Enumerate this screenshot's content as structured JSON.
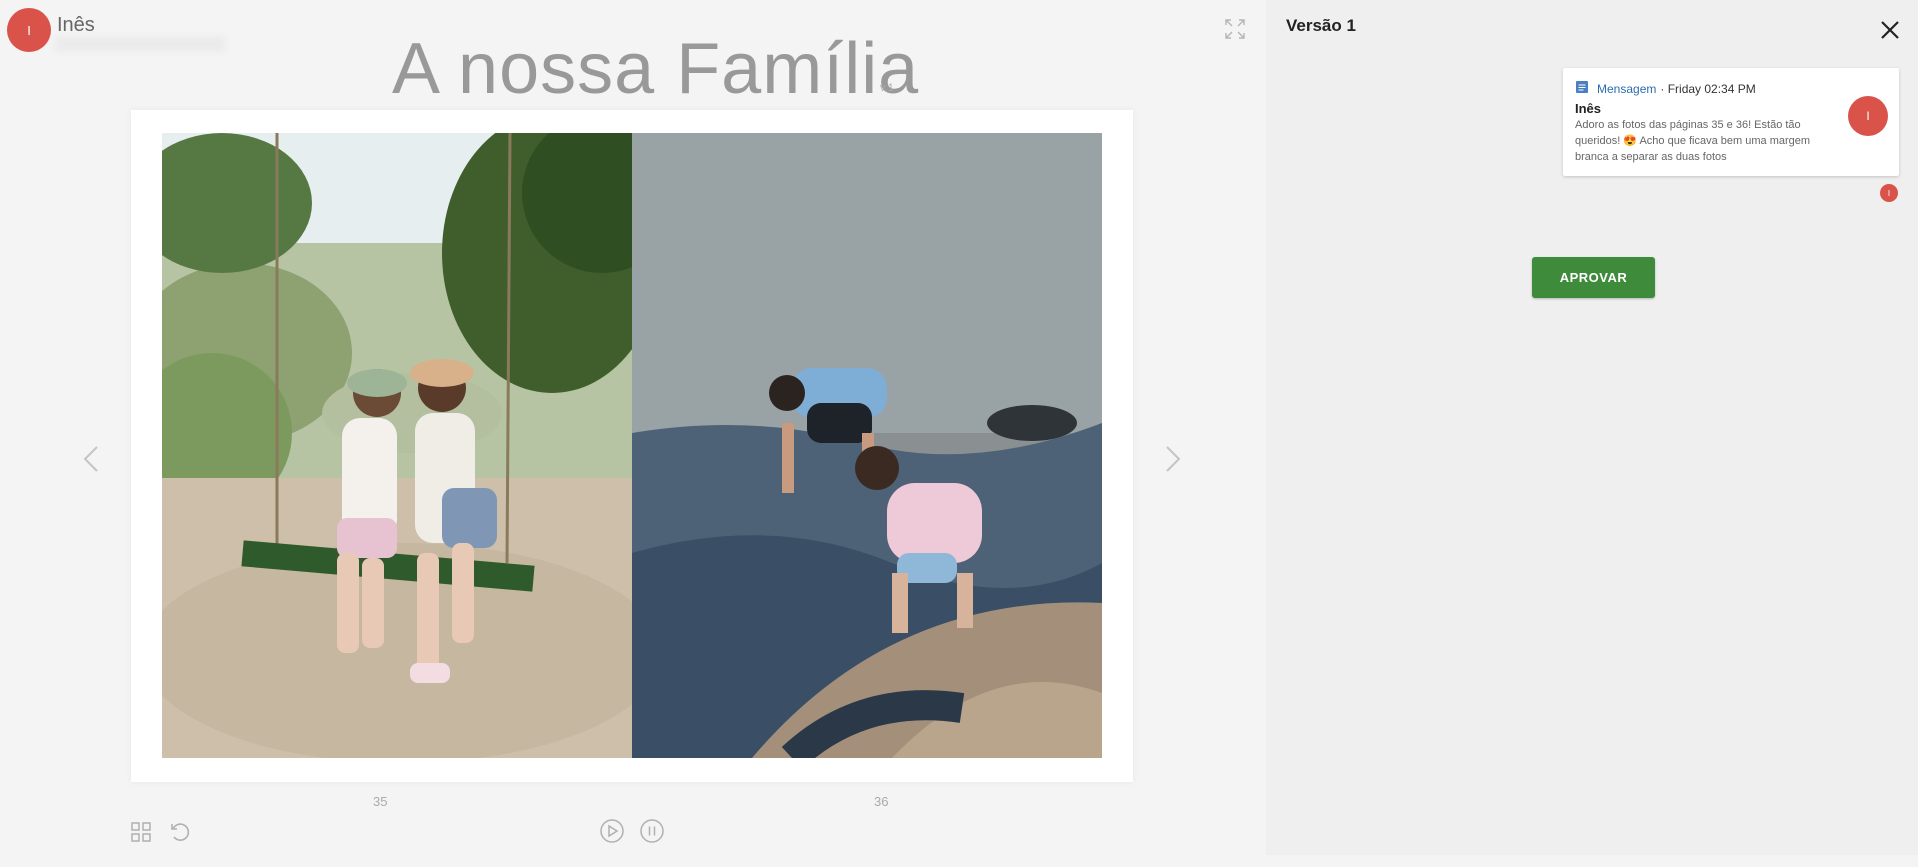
{
  "user": {
    "initial": "I",
    "name": "Inês"
  },
  "album": {
    "title": "A nossa Família",
    "version": "v.1"
  },
  "pages": {
    "left_number": "35",
    "right_number": "36"
  },
  "icons": {
    "expand": "expand-icon",
    "prev": "chevron-left-icon",
    "next": "chevron-right-icon",
    "grid": "grid-icon",
    "undo": "undo-icon",
    "play": "play-icon",
    "pause": "pause-icon",
    "close": "close-icon",
    "message": "document-icon"
  },
  "panel": {
    "title": "Versão 1",
    "comment": {
      "type": "Mensagem",
      "time": "· Friday 02:34 PM",
      "author": "Inês",
      "text": "Adoro as fotos das páginas 35 e 36! Estão tão queridos! 😍 Acho que ficava bem uma margem branca a separar as duas fotos",
      "avatar_initial": "I"
    },
    "approve_label": "APROVAR"
  },
  "colors": {
    "avatar": "#d9534a",
    "approve": "#3f8b3c",
    "link": "#2c6cb0"
  }
}
